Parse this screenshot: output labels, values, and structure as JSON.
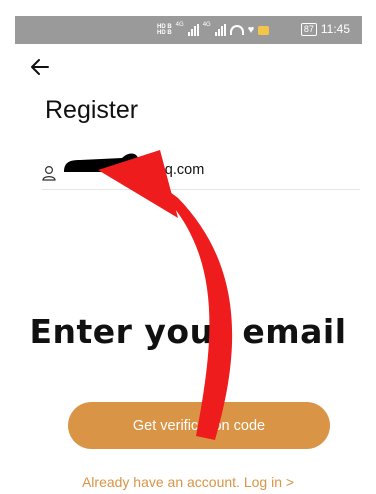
{
  "status_bar": {
    "network_1": "HD B",
    "network_2": "HD B",
    "network_type_1": "4G",
    "network_type_2": "4G",
    "battery": "87",
    "time": "11:45",
    "icons": [
      "signal-icon",
      "wifi-icon",
      "heart-icon",
      "message-icon",
      "battery-icon"
    ]
  },
  "header": {
    "back_icon": "arrow-left-icon",
    "title": "Register"
  },
  "form": {
    "email_icon": "user-icon",
    "email_value": "@qq.com"
  },
  "annotation": {
    "caption": "Enter your email",
    "arrow_color": "#ee1c1c"
  },
  "actions": {
    "primary_label": "Get verification code",
    "login_link": "Already have an account. Log in >"
  },
  "colors": {
    "accent": "#d99445",
    "status_bar": "#9a9a9a"
  }
}
